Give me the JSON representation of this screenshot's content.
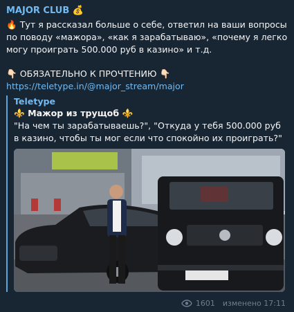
{
  "channel": {
    "name": "MAJOR CLUB",
    "badge_icon": "money-bag-icon"
  },
  "post": {
    "intro_emoji": "🔥",
    "intro": "Тут я рассказал больше о себе, ответил на ваши вопросы по поводу «мажора», «как я зарабатываю», «почему я легко могу проиграть 500.000 руб в казино» и т.д.",
    "must_read_emoji": "👇🏻",
    "must_read": "ОБЯЗАТЕЛЬНО К ПРОЧТЕНИЮ",
    "link": "https://teletype.in/@major_stream/major"
  },
  "preview": {
    "site": "Teletype",
    "title_emoji": "⚜️",
    "title": "Мажор из трущоб",
    "description": "\"На чем ты зарабатываешь?\", \"Откуда у тебя 500.000 руб в казино, чтобы ты мог если что спокойно их проиграть?\"",
    "image_icon": "preview-photo"
  },
  "meta": {
    "views": "1601",
    "edited": "изменено 17:11",
    "view_icon": "eye-icon"
  },
  "colors": {
    "background": "#182533",
    "accent": "#71baf2",
    "muted": "#6d7f8f"
  }
}
